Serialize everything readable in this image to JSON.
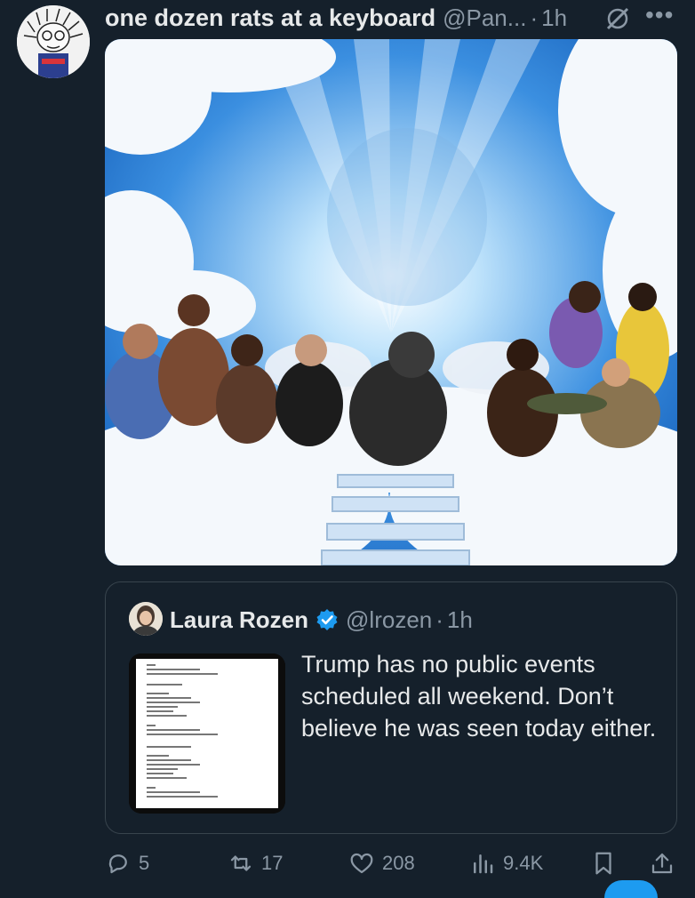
{
  "post": {
    "author_name": "one dozen rats at a keyboard",
    "author_handle": "@Pan...",
    "separator": "·",
    "time": "1h",
    "avatar_icon": "cartoon-avatar-icon",
    "grok_icon": "grok-slash-icon",
    "more_label": "•••"
  },
  "media": {
    "type": "image",
    "icon": "heaven-collage-image"
  },
  "quote": {
    "author_name": "Laura Rozen",
    "verified_icon": "verified-badge-icon",
    "author_handle": "@lrozen",
    "separator": "·",
    "time": "1h",
    "text": "Trump has no public events scheduled all weekend. Don’t believe he was seen today either."
  },
  "actions": {
    "replies": "5",
    "retweets": "17",
    "likes": "208",
    "views": "9.4K"
  },
  "colors": {
    "background": "#15202b",
    "text": "#e7e9ea",
    "muted": "#8b98a5",
    "accent": "#1d9bf0",
    "border": "#38444d"
  }
}
